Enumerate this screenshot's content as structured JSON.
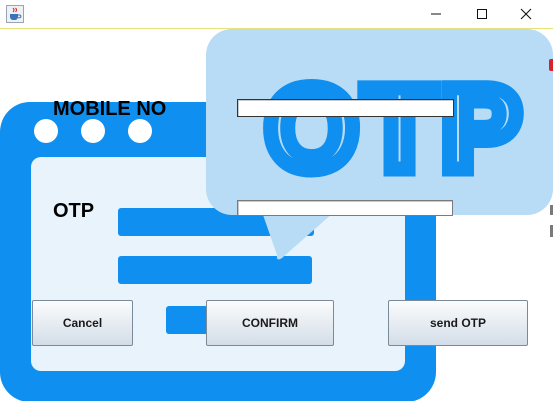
{
  "window": {
    "app_icon": "java-cup-icon",
    "controls": [
      "minimize-icon",
      "maximize-icon",
      "close-icon"
    ]
  },
  "artwork": {
    "bubble_text": "OTP",
    "colors": {
      "frame_blue": "#0f8ff0",
      "bubble": "#b8dcf5",
      "panel": "#e8f3fb"
    }
  },
  "form": {
    "mobile_label": "MOBILE NO",
    "mobile_value": "",
    "otp_label": "OTP",
    "otp_value": ""
  },
  "buttons": {
    "cancel": "Cancel",
    "confirm": "CONFIRM",
    "send_otp": "send OTP"
  }
}
